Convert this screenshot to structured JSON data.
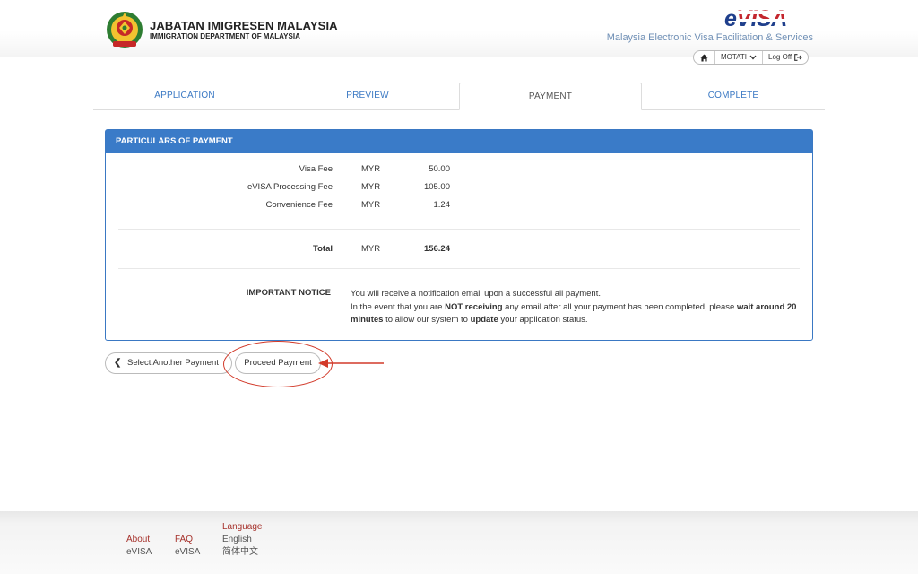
{
  "header": {
    "org_title": "JABATAN IMIGRESEN MALAYSIA",
    "org_subtitle": "IMMIGRATION DEPARTMENT OF MALAYSIA",
    "brand": "eVISA",
    "brand_tagline": "Malaysia Electronic Visa Facilitation & Services",
    "user_name": "MOTATI",
    "logout_label": "Log Off"
  },
  "tabs": [
    {
      "label": "APPLICATION",
      "active": false
    },
    {
      "label": "PREVIEW",
      "active": false
    },
    {
      "label": "PAYMENT",
      "active": true
    },
    {
      "label": "COMPLETE",
      "active": false
    }
  ],
  "panel": {
    "title": "PARTICULARS OF PAYMENT",
    "fees": [
      {
        "label": "Visa Fee",
        "currency": "MYR",
        "amount": "50.00"
      },
      {
        "label": "eVISA Processing Fee",
        "currency": "MYR",
        "amount": "105.00"
      },
      {
        "label": "Convenience Fee",
        "currency": "MYR",
        "amount": "1.24"
      }
    ],
    "total": {
      "label": "Total",
      "currency": "MYR",
      "amount": "156.24"
    },
    "notice": {
      "label": "IMPORTANT NOTICE",
      "line1": "You will receive a notification email upon a successful all payment.",
      "line2_a": "In the event that you are ",
      "line2_b": "NOT receiving",
      "line2_c": " any email after all your payment has been completed, please ",
      "line2_d": "wait around 20 minutes",
      "line2_e": " to allow our system to ",
      "line2_f": "update",
      "line2_g": " your application status."
    }
  },
  "buttons": {
    "back": "Select Another Payment",
    "proceed": "Proceed Payment"
  },
  "footer": {
    "about": "About",
    "about_sub": "eVISA",
    "faq": "FAQ",
    "faq_sub": "eVISA",
    "language": "Language",
    "lang_en": "English",
    "lang_zh": "简体中文"
  },
  "colors": {
    "accent": "#3a7bc8",
    "annotation": "#d23a2a",
    "footer_link": "#a5302a"
  }
}
